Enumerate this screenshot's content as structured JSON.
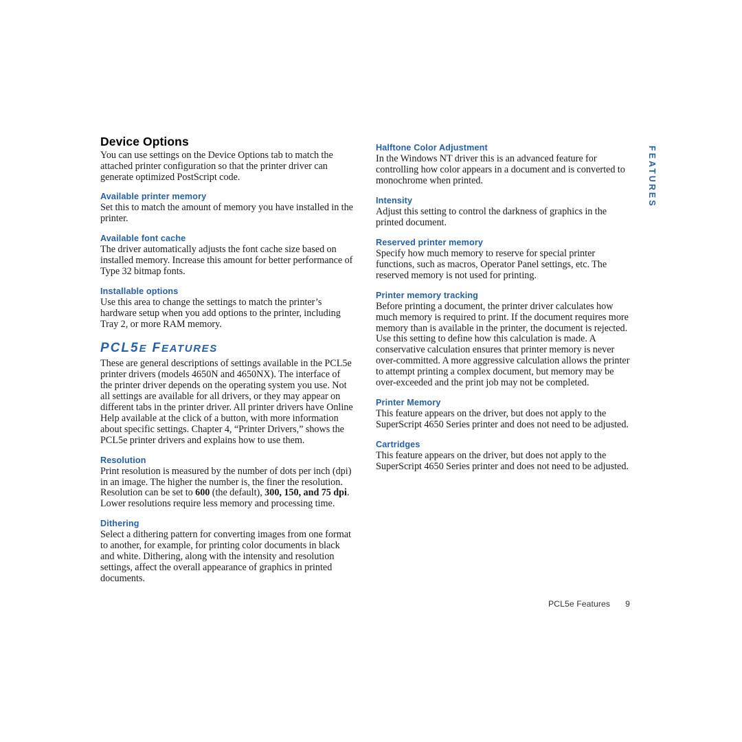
{
  "document": {
    "page_number": "9",
    "footer_label": "PCL5e Features",
    "side_tab": "FEATURES",
    "accent_color": "#2560A8"
  },
  "left_column": {
    "chapter_title": "Device Options",
    "intro": "You can use settings on the Device Options tab to match the attached printer configuration so that the printer driver can generate optimized PostScript code.",
    "sections": [
      {
        "heading": "Available printer memory",
        "body": "Set this to match the amount of memory you have installed in the printer."
      },
      {
        "heading": "Available font cache",
        "body": "The driver automatically adjusts the font cache size based on installed memory. Increase this amount for better performance of Type 32 bitmap fonts."
      },
      {
        "heading": "Installable options",
        "body": "Use this area to change the settings to match the printer’s hardware setup when you add options to the printer, including Tray 2, or more RAM memory."
      }
    ],
    "section_head_main": "PCL5",
    "section_head_small_1": "E",
    "section_head_mid": " F",
    "section_head_small_2": "EATURES",
    "section_head_full": "PCL5E FEATURES",
    "section_intro": "These are general descriptions of settings available in the PCL5e printer drivers (models 4650N and 4650NX). The interface of the printer driver depends on the operating system you use. Not all settings are available for all drivers, or they may appear on different tabs in the printer driver. All printer drivers have Online Help available at the click of a button, with more information about specific settings. Chapter 4, “Printer Drivers,” shows the PCL5e printer drivers and explains how to use them.",
    "sections_after": [
      {
        "heading": "Resolution",
        "body_part_1": "Print resolution is measured by the number of dots per inch (dpi) in an image. The higher the number is, the finer the resolution. Resolution can be set to ",
        "bold_1": "600",
        "body_part_2": " (the default), ",
        "bold_2": "300, 150, and 75 dpi",
        "body_part_3": ". Lower resolutions require less memory and processing time."
      },
      {
        "heading": "Dithering",
        "body": "Select a dithering pattern for converting images from one format to another, for example, for printing color documents in black and white. Dithering, along with the intensity and resolution settings, affect the overall appearance of graphics in printed documents."
      }
    ]
  },
  "right_column": {
    "sections": [
      {
        "heading": "Halftone Color Adjustment",
        "body": "In the Windows NT driver this is an advanced feature for controlling how color appears in a document and is converted to monochrome when printed."
      },
      {
        "heading": "Intensity",
        "body": "Adjust this setting to control the darkness of graphics in the printed document."
      },
      {
        "heading": "Reserved printer memory",
        "body": "Specify how much memory to reserve for special printer functions, such as macros, Operator Panel settings, etc. The reserved memory is not used for printing."
      },
      {
        "heading": "Printer memory tracking",
        "body": "Before printing a document, the printer driver calculates how much memory is required to print. If the document requires more memory than is available in the printer, the document is rejected. Use this setting to define how this calculation is made. A conservative calculation ensures that printer memory is never over-committed. A more aggressive calculation allows the printer to attempt printing a complex document, but memory may be over-exceeded and the print job may not be completed."
      },
      {
        "heading": "Printer Memory",
        "body": "This feature appears on the driver, but does not apply to the SuperScript 4650 Series printer and does not need to be adjusted."
      },
      {
        "heading": "Cartridges",
        "body": "This feature appears on the driver, but does not apply to the SuperScript 4650 Series printer and does not need to be adjusted."
      }
    ]
  }
}
